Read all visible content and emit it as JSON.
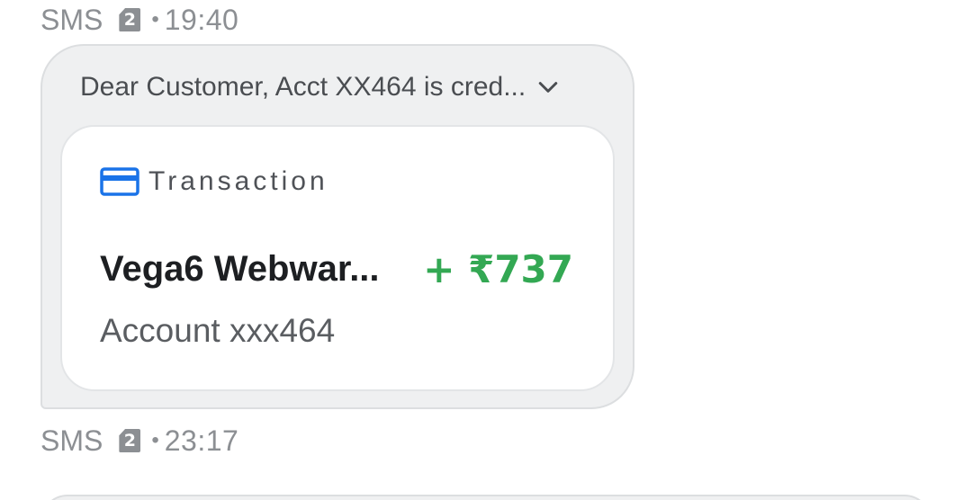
{
  "messages": [
    {
      "source": "SMS",
      "sim": "2",
      "separator": "•",
      "time": "19:40",
      "preview": "Dear Customer, Acct XX464 is cred...",
      "card": {
        "icon": "credit-card-icon",
        "label": "Transaction",
        "merchant": "Vega6 Webwar...",
        "amount": "+ ₹737",
        "account": "Account xxx464"
      }
    },
    {
      "source": "SMS",
      "sim": "2",
      "separator": "•",
      "time": "23:17"
    }
  ],
  "colors": {
    "bubble_bg": "#eff0f1",
    "card_bg": "#ffffff",
    "amount_credit": "#33a853",
    "card_icon": "#1a73e8",
    "meta_text": "#8c8f93"
  }
}
